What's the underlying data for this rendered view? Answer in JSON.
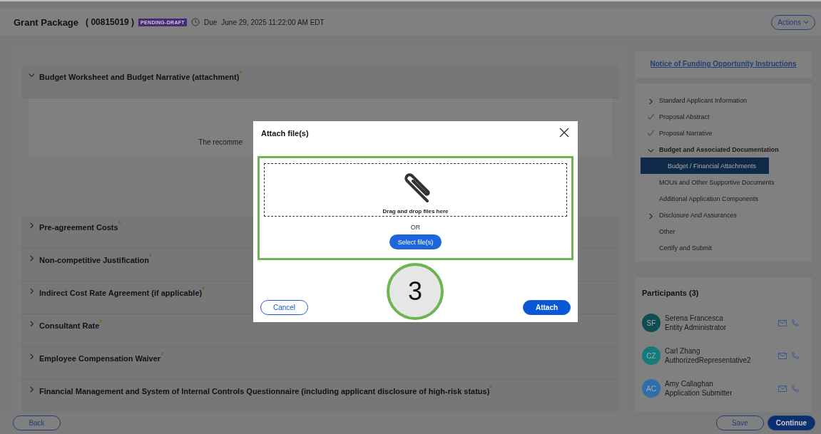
{
  "header": {
    "title": "Grant Package",
    "record_id": "( 00815019 )",
    "status_badge": "PENDING-DRAFT",
    "due_label": "Due",
    "due_date": "June 29, 2025 11:22:00 AM EDT",
    "actions_button": "Actions"
  },
  "sections": [
    {
      "title": "Budget Worksheet and Budget Narrative (attachment)",
      "required": "*",
      "expanded": true,
      "body_text": "The recomme"
    },
    {
      "title": "Pre-agreement Costs",
      "required": "*",
      "expanded": false
    },
    {
      "title": "Non-competitive Justification",
      "required": "*",
      "expanded": false
    },
    {
      "title": "Indirect Cost Rate Agreement (if applicable)",
      "required": "*",
      "expanded": false
    },
    {
      "title": "Consultant Rate",
      "required": "*",
      "expanded": false
    },
    {
      "title": "Employee Compensation Waiver",
      "required": "*",
      "expanded": false
    },
    {
      "title": "Financial Management and System of Internal Controls Questionnaire (including applicant disclosure of high-risk status)",
      "required": "*",
      "expanded": false
    }
  ],
  "sidebar": {
    "instructions_link": "Notice of Funding Opportunity Instructions",
    "nav": [
      {
        "label": "Standard Applicant Information",
        "kind": "collapsed",
        "selected": false
      },
      {
        "label": "Proposal Abstract",
        "kind": "done",
        "selected": false
      },
      {
        "label": "Proposal Narrative",
        "kind": "done",
        "selected": false
      },
      {
        "label": "Budget and Associated Documentation",
        "kind": "expanded",
        "selected": false,
        "children": [
          {
            "label": "Budget / Financial Attachments",
            "selected": true
          },
          {
            "label": "MOUs and Other Supportive Documents",
            "selected": false
          },
          {
            "label": "Additional Application Components",
            "selected": false
          }
        ]
      },
      {
        "label": "Disclosure And Assurances",
        "kind": "collapsed",
        "selected": false
      },
      {
        "label": "Other",
        "kind": "plain",
        "selected": false
      },
      {
        "label": "Certify and Submit",
        "kind": "plain",
        "selected": false
      }
    ],
    "participants_title": "Participants",
    "participants_count": "(3)",
    "participants": [
      {
        "initials": "SF",
        "name": "Serena Francesca",
        "role": "Entity Administrator",
        "color": "#0f4d52"
      },
      {
        "initials": "CZ",
        "name": "Carl Zhang",
        "role": "AuthorizedRepresentative2",
        "color": "#147a7a"
      },
      {
        "initials": "AC",
        "name": "Amy Callaghan",
        "role": "Application Submitter",
        "color": "#2d6fad"
      }
    ]
  },
  "footer": {
    "back": "Back",
    "save": "Save",
    "continue": "Continue"
  },
  "dialog": {
    "title": "Attach file(s)",
    "drop_text": "Drag and drop files here",
    "or_text": "OR",
    "select_button": "Select file(s)",
    "cancel": "Cancel",
    "attach": "Attach"
  },
  "step_marker": "3"
}
